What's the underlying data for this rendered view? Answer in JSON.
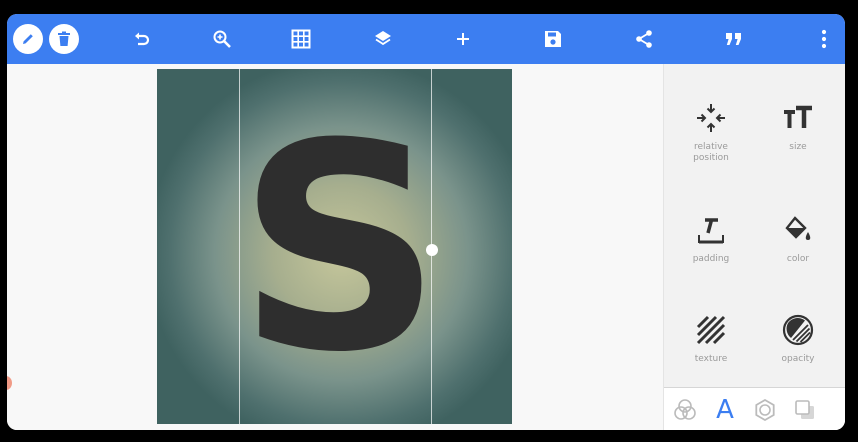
{
  "colors": {
    "toolbar": "#3c7ef1",
    "accent": "#3c7ef1",
    "letter": "#2e2e2e"
  },
  "toolbar": {
    "icons": [
      "pencil-icon",
      "trash-icon",
      "undo-icon",
      "zoom-in-icon",
      "grid-icon",
      "layers-icon",
      "add-icon",
      "save-icon",
      "share-icon",
      "quote-icon",
      "more-icon"
    ]
  },
  "canvas": {
    "text": "S"
  },
  "panel": {
    "tools": [
      {
        "id": "relative-position",
        "label": "relative\nposition",
        "icon": "relative-position-icon"
      },
      {
        "id": "size",
        "label": "size",
        "icon": "text-size-icon"
      },
      {
        "id": "padding",
        "label": "padding",
        "icon": "padding-icon"
      },
      {
        "id": "color",
        "label": "color",
        "icon": "paint-bucket-icon"
      },
      {
        "id": "texture",
        "label": "texture",
        "icon": "texture-icon"
      },
      {
        "id": "opacity",
        "label": "opacity",
        "icon": "opacity-icon"
      }
    ],
    "tabs": [
      {
        "icon": "blend-icon"
      },
      {
        "icon": "text-tab-icon",
        "glyph": "A",
        "active": true
      },
      {
        "icon": "stroke-icon"
      },
      {
        "icon": "shadow-icon"
      }
    ]
  }
}
